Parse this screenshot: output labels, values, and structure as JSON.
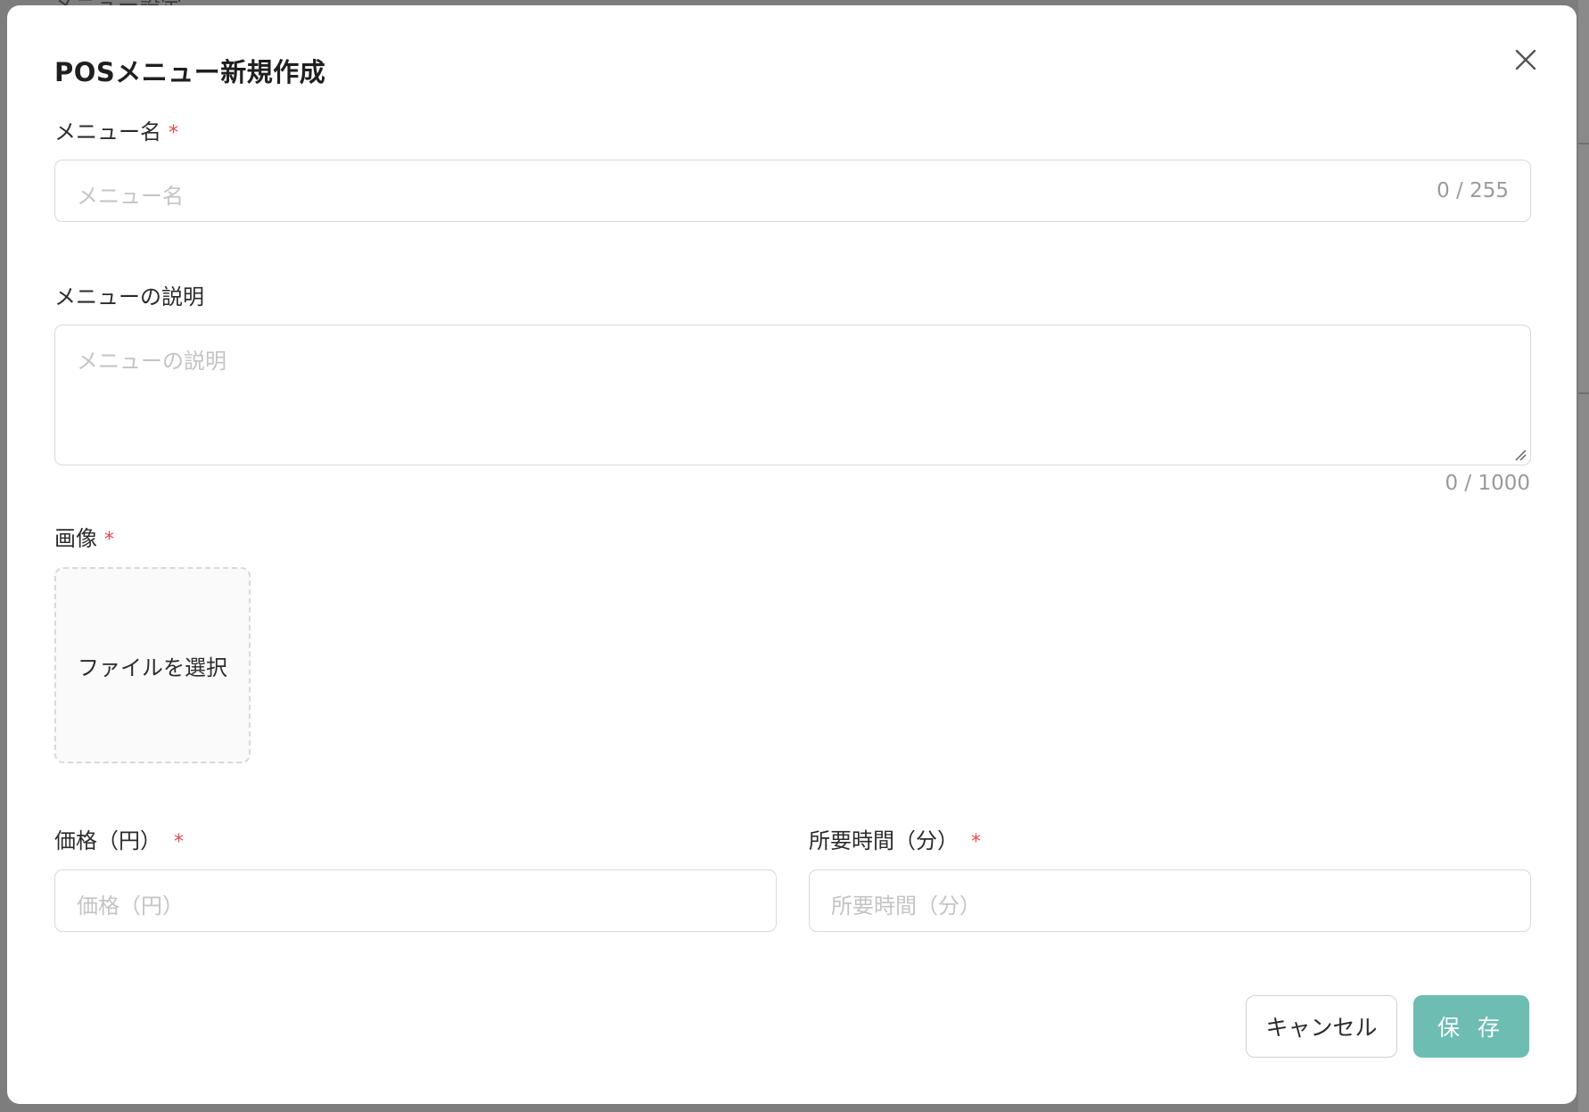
{
  "background": {
    "peek_text": "メニュー設定"
  },
  "modal": {
    "title": "POSメニュー新規作成",
    "close_icon": "close-icon"
  },
  "fields": {
    "menu_name": {
      "label": "メニュー名",
      "required_mark": "*",
      "placeholder": "メニュー名",
      "counter": "0 / 255"
    },
    "menu_description": {
      "label": "メニューの説明",
      "placeholder": "メニューの説明",
      "counter": "0 / 1000"
    },
    "image": {
      "label": "画像",
      "required_mark": "*",
      "upload_label": "ファイルを選択"
    },
    "price": {
      "label": "価格（円）",
      "required_mark": "*",
      "placeholder": "価格（円）"
    },
    "duration": {
      "label": "所要時間（分）",
      "required_mark": "*",
      "placeholder": "所要時間（分）"
    }
  },
  "footer": {
    "cancel_label": "キャンセル",
    "save_label": "保 存"
  },
  "colors": {
    "accent": "#6dbdb3",
    "required": "#e5484d",
    "border": "#d9d9d9",
    "placeholder": "#c4c4c4"
  }
}
